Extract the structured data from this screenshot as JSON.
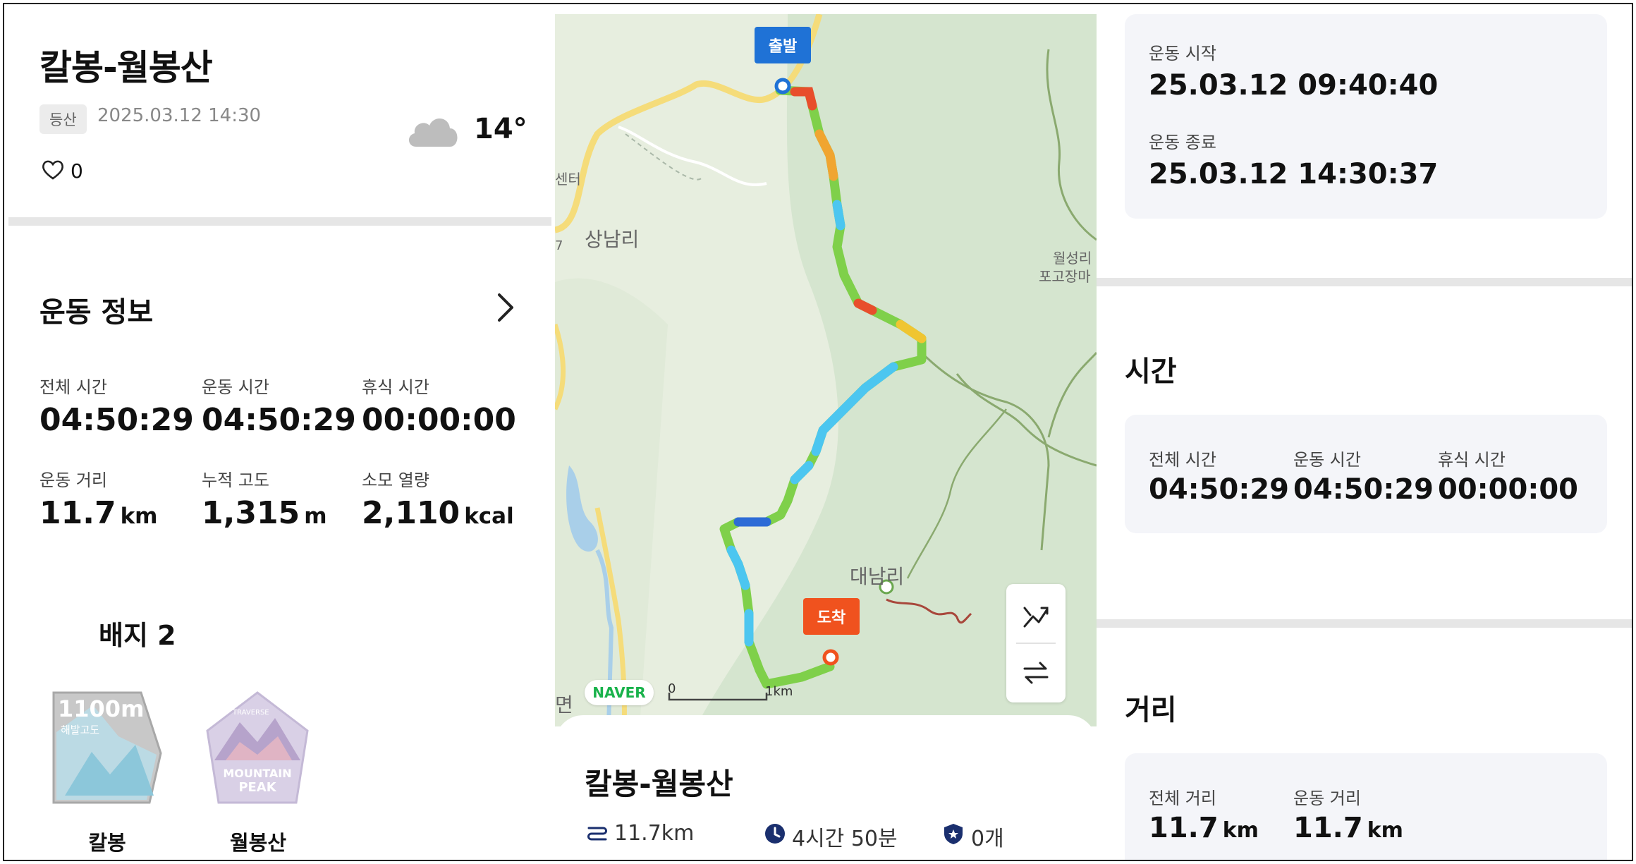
{
  "header": {
    "title": "칼봉-월봉산",
    "tag": "등산",
    "date": "2025.03.12 14:30",
    "weather_icon": "cloud-icon",
    "temperature": "14°",
    "likes": "0"
  },
  "workout": {
    "section_title": "운동 정보",
    "stats": [
      {
        "label": "전체 시간",
        "value": "04:50:29",
        "unit": ""
      },
      {
        "label": "운동 시간",
        "value": "04:50:29",
        "unit": ""
      },
      {
        "label": "휴식 시간",
        "value": "00:00:00",
        "unit": ""
      },
      {
        "label": "운동 거리",
        "value": "11.7",
        "unit": "km"
      },
      {
        "label": "누적 고도",
        "value": "1,315",
        "unit": "m"
      },
      {
        "label": "소모 열량",
        "value": "2,110",
        "unit": "kcal"
      }
    ]
  },
  "badges": {
    "section_title": "배지 2",
    "items": [
      {
        "name": "칼봉",
        "emblem_line1": "1100m",
        "emblem_line2": "해발고도"
      },
      {
        "name": "월봉산",
        "emblem_line1": "MOUNTAIN",
        "emblem_line2": "PEAK",
        "emblem_arc": "TRAVERSE"
      }
    ]
  },
  "map": {
    "start_label": "출발",
    "end_label": "도착",
    "places": [
      "상남리",
      "대남리",
      "월성리",
      "포고장마",
      "센터",
      "면",
      "7"
    ],
    "logo": "NAVER",
    "scale_start": "0",
    "scale_end": "1km",
    "colors": {
      "start": "#1f72d6",
      "end": "#f0521e",
      "road": "#f5dc7a"
    }
  },
  "route_card": {
    "title": "칼봉-월봉산",
    "distance": "11.7km",
    "duration": "4시간 50분",
    "badges": "0개"
  },
  "right": {
    "start_label": "운동 시작",
    "start_value": "25.03.12 09:40:40",
    "end_label": "운동 종료",
    "end_value": "25.03.12 14:30:37",
    "time_section": "시간",
    "time_stats": [
      {
        "label": "전체 시간",
        "value": "04:50:29"
      },
      {
        "label": "운동 시간",
        "value": "04:50:29"
      },
      {
        "label": "휴식 시간",
        "value": "00:00:00"
      }
    ],
    "distance_section": "거리",
    "distance_stats": [
      {
        "label": "전체 거리",
        "value": "11.7",
        "unit": "km"
      },
      {
        "label": "운동 거리",
        "value": "11.7",
        "unit": "km"
      }
    ]
  }
}
